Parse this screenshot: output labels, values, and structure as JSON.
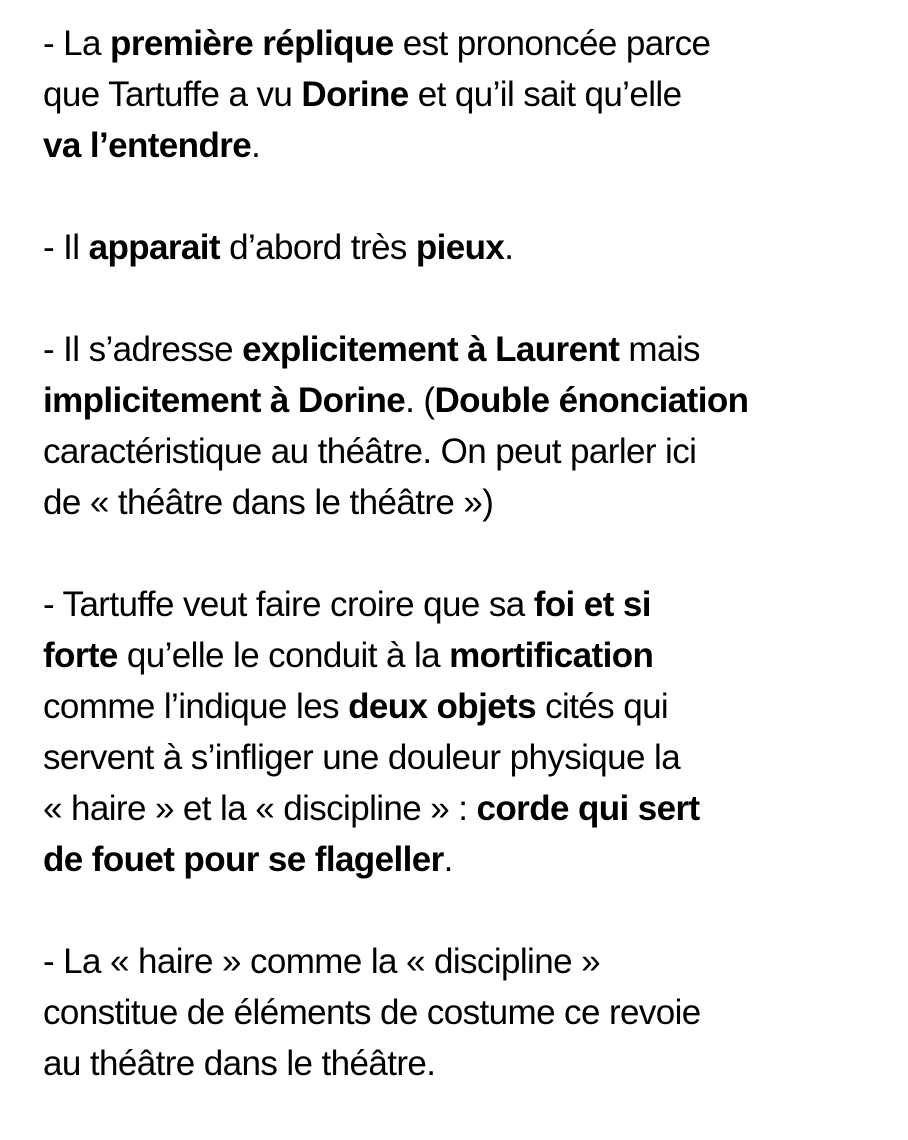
{
  "paragraphs": [
    {
      "lines": [
        [
          {
            "t": "- La ",
            "b": false
          },
          {
            "t": "première réplique",
            "b": true
          },
          {
            "t": " est prononcée parce",
            "b": false
          }
        ],
        [
          {
            "t": "que Tartuffe a vu ",
            "b": false
          },
          {
            "t": "Dorine",
            "b": true
          },
          {
            "t": " et qu’il sait qu’elle",
            "b": false
          }
        ],
        [
          {
            "t": "va l’entendre",
            "b": true
          },
          {
            "t": ".",
            "b": false
          }
        ]
      ]
    },
    {
      "lines": [
        [
          {
            "t": "- Il ",
            "b": false
          },
          {
            "t": "apparait",
            "b": true
          },
          {
            "t": " d’abord très ",
            "b": false
          },
          {
            "t": "pieux",
            "b": true
          },
          {
            "t": ".",
            "b": false
          }
        ]
      ]
    },
    {
      "lines": [
        [
          {
            "t": "- Il s’adresse ",
            "b": false
          },
          {
            "t": "explicitement à Laurent",
            "b": true
          },
          {
            "t": " mais",
            "b": false
          }
        ],
        [
          {
            "t": "implicitement à Dorine",
            "b": true
          },
          {
            "t": ". (",
            "b": false
          },
          {
            "t": "Double énonciation",
            "b": true
          }
        ],
        [
          {
            "t": "caractéristique au théâtre. On peut parler ici",
            "b": false
          }
        ],
        [
          {
            "t": "de « théâtre dans le théâtre »)",
            "b": false
          }
        ]
      ]
    },
    {
      "lines": [
        [
          {
            "t": "- Tartuffe veut faire croire que sa ",
            "b": false
          },
          {
            "t": "foi et si",
            "b": true
          }
        ],
        [
          {
            "t": "forte",
            "b": true
          },
          {
            "t": " qu’elle le conduit à la ",
            "b": false
          },
          {
            "t": "mortification",
            "b": true
          }
        ],
        [
          {
            "t": "comme l’indique les ",
            "b": false
          },
          {
            "t": "deux objets",
            "b": true
          },
          {
            "t": " cités qui",
            "b": false
          }
        ],
        [
          {
            "t": "servent à s’infliger une douleur physique la",
            "b": false
          }
        ],
        [
          {
            "t": "« haire » et la « discipline » : ",
            "b": false
          },
          {
            "t": "corde qui sert",
            "b": true
          }
        ],
        [
          {
            "t": "de fouet pour se flageller",
            "b": true
          },
          {
            "t": ".",
            "b": false
          }
        ]
      ]
    },
    {
      "lines": [
        [
          {
            "t": "- La « haire » comme la « discipline »",
            "b": false
          }
        ],
        [
          {
            "t": "constitue de éléments de costume ce revoie",
            "b": false
          }
        ],
        [
          {
            "t": "au théâtre dans le théâtre.",
            "b": false
          }
        ]
      ]
    }
  ]
}
